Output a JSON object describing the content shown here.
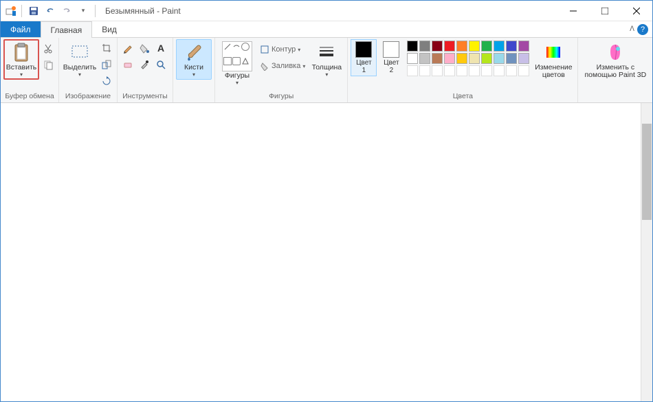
{
  "title": "Безымянный - Paint",
  "tabs": {
    "file": "Файл",
    "home": "Главная",
    "view": "Вид"
  },
  "groups": {
    "clipboard": {
      "label": "Буфер обмена",
      "paste": "Вставить"
    },
    "image": {
      "label": "Изображение",
      "select": "Выделить"
    },
    "tools": {
      "label": "Инструменты"
    },
    "brushes": {
      "label": "",
      "brushes": "Кисти"
    },
    "shapes": {
      "label": "Фигуры",
      "shapes_btn": "Фигуры",
      "outline": "Контур",
      "fill": "Заливка",
      "thickness": "Толщина"
    },
    "colors": {
      "label": "Цвета",
      "color1": "Цвет\n1",
      "color2": "Цвет\n2",
      "edit": "Изменение\nцветов"
    },
    "paint3d": {
      "label": "",
      "btn": "Изменить с\nпомощью Paint 3D"
    }
  },
  "colors": {
    "color1": "#000000",
    "color2": "#ffffff",
    "palette": [
      [
        "#000000",
        "#7f7f7f",
        "#880015",
        "#ed1c24",
        "#ff7f27",
        "#fff200",
        "#22b14c",
        "#00a2e8",
        "#3f48cc",
        "#a349a4"
      ],
      [
        "#ffffff",
        "#c3c3c3",
        "#b97a57",
        "#ffaec9",
        "#ffc90e",
        "#efe4b0",
        "#b5e61d",
        "#99d9ea",
        "#7092be",
        "#c8bfe7"
      ]
    ]
  }
}
